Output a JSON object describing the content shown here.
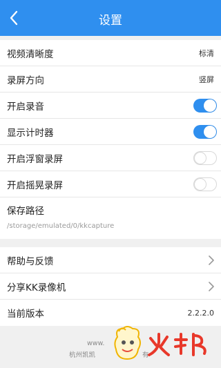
{
  "header": {
    "title": "设置"
  },
  "settings": {
    "video_quality": {
      "label": "视频清晰度",
      "value": "标清"
    },
    "orientation": {
      "label": "录屏方向",
      "value": "竖屏"
    },
    "record_audio": {
      "label": "开启录音",
      "on": true
    },
    "show_timer": {
      "label": "显示计时器",
      "on": true
    },
    "float_window": {
      "label": "开启浮窗录屏",
      "on": false
    },
    "shake_record": {
      "label": "开启摇晃录屏",
      "on": false
    },
    "save_path": {
      "label": "保存路径",
      "path": "/storage/emulated/0/kkcapture"
    }
  },
  "more": {
    "help": {
      "label": "帮助与反馈"
    },
    "share": {
      "label": "分享KK录像机"
    },
    "version": {
      "label": "当前版本",
      "value": "2.2.2.0"
    }
  },
  "footer": {
    "line1": "www.",
    "line2": "杭州凯凯",
    "line2_end": "有"
  },
  "watermark": {
    "text": "火邦"
  },
  "colors": {
    "accent": "#2f8fef",
    "background": "#f0f0f0"
  }
}
